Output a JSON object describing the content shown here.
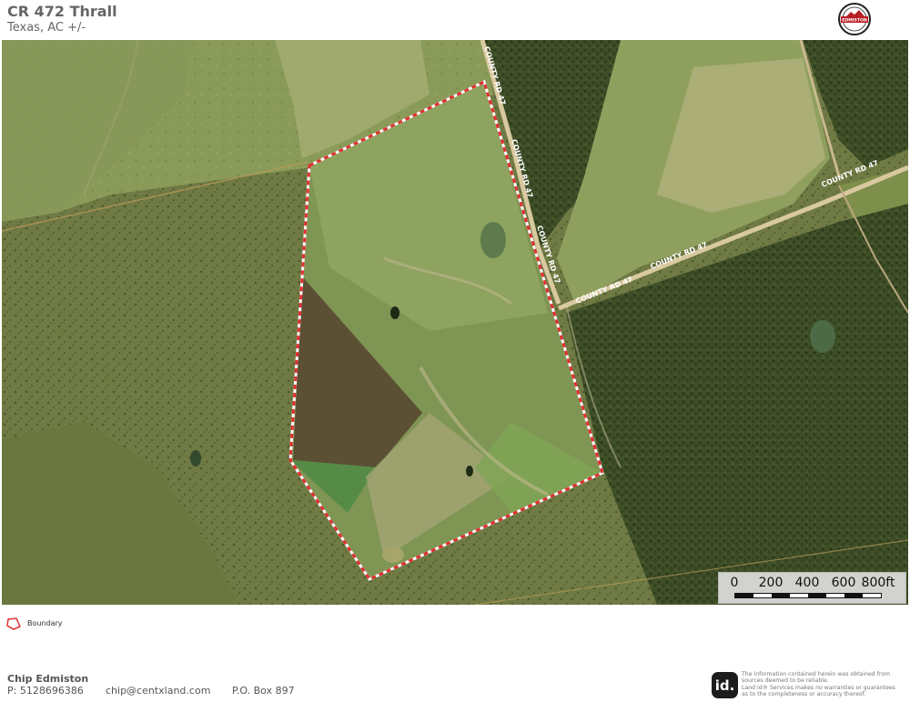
{
  "header": {
    "title": "CR 472 Thrall",
    "subtitle": "Texas,  AC +/-",
    "brand_logo_text": "EDMISTON"
  },
  "map": {
    "road_labels": [
      "COUNTY RD 47",
      "COUNTY RD 47",
      "COUNTY RD 47",
      "COUNTY RD 47",
      "COUNTY RD 47"
    ],
    "boundary_color": "#e03030",
    "road_color": "#d9c9a0"
  },
  "scalebar": {
    "ticks": [
      "0",
      "200",
      "400",
      "600",
      "800ft"
    ]
  },
  "legend": {
    "boundary_label": "Boundary"
  },
  "footer": {
    "agent_name": "Chip Edmiston",
    "phone": "P: 5128696386",
    "email": "chip@centxland.com",
    "address": "P.O. Box 897",
    "logo_text": "id.",
    "disclaimer": [
      "The information contained herein was obtained from",
      "sources deemed to be reliable.",
      "Land id® Services makes no warranties or guarantees",
      "as to the completeness or accuracy thereof."
    ]
  }
}
